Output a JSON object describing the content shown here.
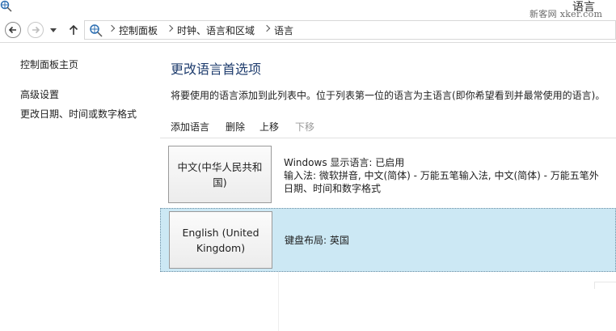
{
  "window": {
    "title": "语言"
  },
  "watermark": {
    "text": "新客网 xker.com"
  },
  "breadcrumb": {
    "items": [
      "控制面板",
      "时钟、语言和区域",
      "语言"
    ]
  },
  "left_nav": {
    "home": "控制面板主页",
    "advanced": "高级设置",
    "date_format": "更改日期、时间或数字格式"
  },
  "main": {
    "title": "更改语言首选项",
    "description": "将要使用的语言添加到此列表中。位于列表第一位的语言为主语言(即你希望看到并最常使用的语言)。",
    "toolbar": {
      "add": "添加语言",
      "remove": "删除",
      "up": "上移",
      "down": "下移"
    },
    "languages": [
      {
        "name": "中文(中华人民共和国)",
        "lines": [
          "Windows 显示语言: 已启用",
          "输入法: 微软拼音, 中文(简体) - 万能五笔输入法, 中文(简体) - 万能五笔外",
          "日期、时间和数字格式"
        ]
      },
      {
        "name": "English (United Kingdom)",
        "lines": [
          "键盘布局: 英国"
        ]
      }
    ]
  },
  "colors": {
    "accent_title": "#1f3d6e",
    "selected_row": "#cce8f4"
  }
}
